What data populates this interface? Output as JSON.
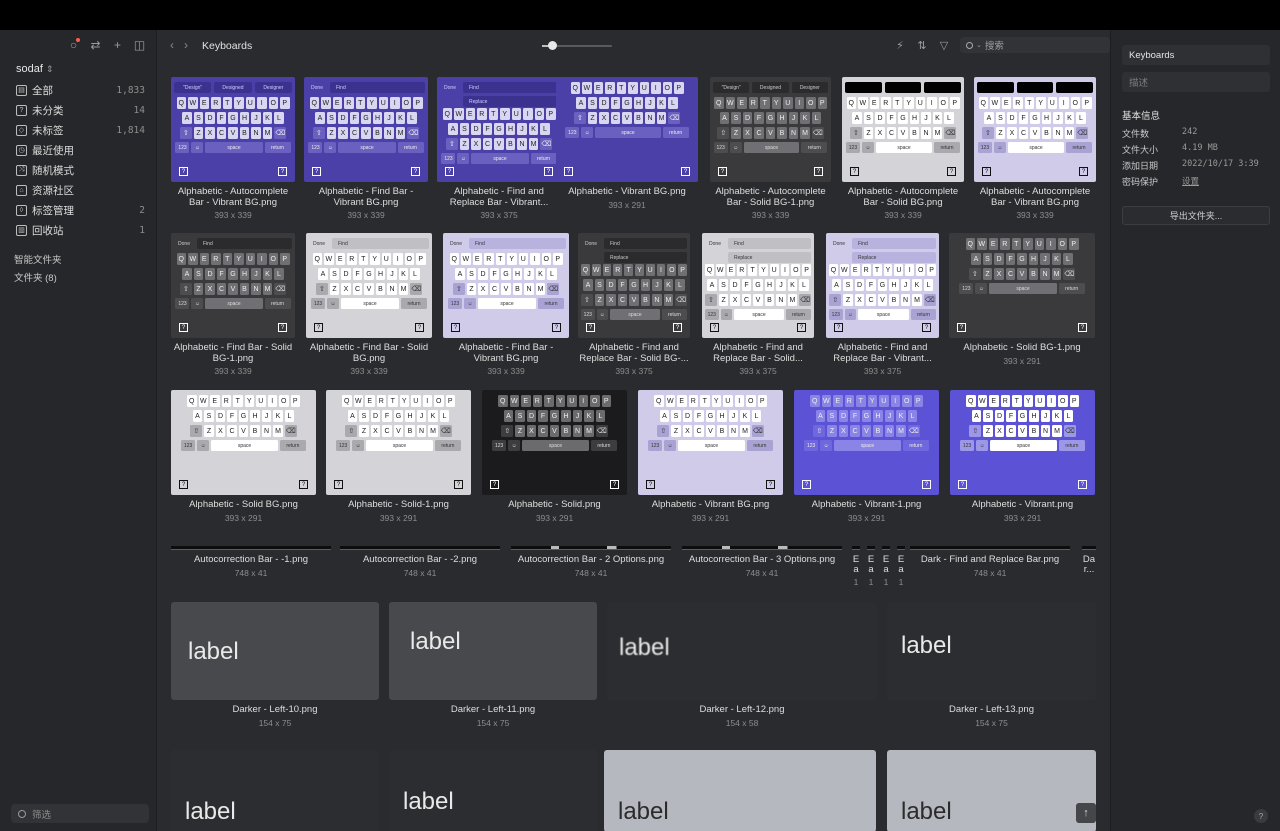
{
  "app": {
    "library": "sodaf",
    "folder": "Keyboards"
  },
  "sidebar": {
    "items": [
      {
        "label": "全部",
        "count": "1,833",
        "icon": "inbox-icon"
      },
      {
        "label": "未分类",
        "count": "14",
        "icon": "unsorted-icon"
      },
      {
        "label": "未标签",
        "count": "1,814",
        "icon": "untagged-icon"
      },
      {
        "label": "最近使用",
        "count": "",
        "icon": "clock-icon"
      },
      {
        "label": "随机模式",
        "count": "",
        "icon": "shuffle-icon"
      },
      {
        "label": "资源社区",
        "count": "",
        "icon": "community-icon"
      },
      {
        "label": "标签管理",
        "count": "2",
        "icon": "tag-icon"
      },
      {
        "label": "回收站",
        "count": "1",
        "icon": "trash-icon"
      }
    ],
    "smart_folders": "智能文件夹",
    "folders": "文件夹 (8)",
    "filter_placeholder": "筛选"
  },
  "toolbar": {
    "title": "Keyboards",
    "search_placeholder": "搜索"
  },
  "inspector": {
    "name": "Keyboards",
    "desc_placeholder": "描述",
    "section": "基本信息",
    "rows": [
      {
        "k": "文件数",
        "v": "242"
      },
      {
        "k": "文件大小",
        "v": "4.19 MB"
      },
      {
        "k": "添加日期",
        "v": "2022/10/17 3:39"
      },
      {
        "k": "密码保护",
        "v": "设置"
      }
    ],
    "export_label": "导出文件夹..."
  },
  "grid": {
    "row1": [
      {
        "cap": "Alphabetic - Autocomplete Bar - Vibrant BG.png",
        "dim": "393 x 339",
        "theme": "vibrant",
        "bar": "auto"
      },
      {
        "cap": "Alphabetic - Find Bar - Vibrant BG.png",
        "dim": "393 x 339",
        "theme": "vibrant",
        "bar": "find"
      },
      {
        "cap": "Alphabetic - Find and Replace Bar - Vibrant...",
        "dim": "393 x 375",
        "theme": "vibrant",
        "bar": "replace"
      },
      {
        "cap": "Alphabetic - Vibrant BG.png",
        "dim": "393 x 291",
        "theme": "vibrant",
        "bar": "none"
      },
      {
        "cap": "Alphabetic - Autocomplete Bar - Solid BG-1.png",
        "dim": "393 x 339",
        "theme": "dark",
        "bar": "auto"
      },
      {
        "cap": "Alphabetic - Autocomplete Bar - Solid BG.png",
        "dim": "393 x 339",
        "theme": "light",
        "bar": "black"
      },
      {
        "cap": "Alphabetic - Autocomplete Bar - Vibrant BG.png",
        "dim": "393 x 339",
        "theme": "lavender",
        "bar": "black"
      }
    ],
    "row2": [
      {
        "cap": "Alphabetic - Find Bar - Solid BG-1.png",
        "dim": "393 x 339",
        "theme": "dark",
        "bar": "find"
      },
      {
        "cap": "Alphabetic - Find Bar - Solid BG.png",
        "dim": "393 x 339",
        "theme": "light",
        "bar": "find"
      },
      {
        "cap": "Alphabetic - Find Bar - Vibrant BG.png",
        "dim": "393 x 339",
        "theme": "lavender",
        "bar": "find"
      },
      {
        "cap": "Alphabetic - Find and Replace Bar - Solid BG-...",
        "dim": "393 x 375",
        "theme": "dark",
        "bar": "replace"
      },
      {
        "cap": "Alphabetic - Find and Replace Bar - Solid...",
        "dim": "393 x 375",
        "theme": "light",
        "bar": "replace"
      },
      {
        "cap": "Alphabetic - Find and Replace Bar - Vibrant...",
        "dim": "393 x 375",
        "theme": "lavender",
        "bar": "replace"
      },
      {
        "cap": "Alphabetic - Solid BG-1.png",
        "dim": "393 x 291",
        "theme": "dark",
        "bar": "none"
      }
    ],
    "row3": [
      {
        "cap": "Alphabetic - Solid BG.png",
        "dim": "393 x 291",
        "theme": "light",
        "bar": "none"
      },
      {
        "cap": "Alphabetic - Solid-1.png",
        "dim": "393 x 291",
        "theme": "light",
        "bar": "none"
      },
      {
        "cap": "Alphabetic - Solid.png",
        "dim": "393 x 291",
        "theme": "black",
        "bar": "none"
      },
      {
        "cap": "Alphabetic - Vibrant BG.png",
        "dim": "393 x 291",
        "theme": "lavender",
        "bar": "none"
      },
      {
        "cap": "Alphabetic - Vibrant-1.png",
        "dim": "393 x 291",
        "theme": "blue",
        "bar": "none"
      },
      {
        "cap": "Alphabetic - Vibrant.png",
        "dim": "393 x 291",
        "theme": "bluelight",
        "bar": "none"
      }
    ],
    "row4": [
      {
        "cap": "Autocorrection Bar - -1.png",
        "dim": "748 x 41"
      },
      {
        "cap": "Autocorrection Bar - -2.png",
        "dim": "748 x 41"
      },
      {
        "cap": "Autocorrection Bar - 2 Options.png",
        "dim": "748 x 41"
      },
      {
        "cap": "Autocorrection Bar - 3 Options.png",
        "dim": "748 x 41"
      },
      {
        "cap": "E",
        "dim": "1",
        "sub": "a"
      },
      {
        "cap": "E",
        "dim": "1",
        "sub": "a"
      },
      {
        "cap": "E",
        "dim": "1",
        "sub": "a"
      },
      {
        "cap": "E",
        "dim": "1",
        "sub": "a"
      },
      {
        "cap": "Dark - Find and Replace Bar.png",
        "dim": "748 x 41"
      },
      {
        "cap": "Da",
        "dim": "",
        "sub": "r..."
      }
    ],
    "row5": [
      {
        "cap": "Darker - Left-10.png",
        "dim": "154 x 75",
        "word": "label"
      },
      {
        "cap": "Darker - Left-11.png",
        "dim": "154 x 75",
        "word": "label"
      },
      {
        "cap": "Darker - Left-12.png",
        "dim": "154 x 58",
        "word": "label"
      },
      {
        "cap": "Darker - Left-13.png",
        "dim": "154 x 75",
        "word": "label"
      }
    ],
    "row6": [
      {
        "word": "label"
      },
      {
        "word": "label"
      },
      {
        "word": "label"
      },
      {
        "word": "label"
      }
    ]
  },
  "keys": {
    "row1": [
      "Q",
      "W",
      "E",
      "R",
      "T",
      "Y",
      "U",
      "I",
      "O",
      "P"
    ],
    "row2": [
      "A",
      "S",
      "D",
      "F",
      "G",
      "H",
      "J",
      "K",
      "L"
    ],
    "row3": [
      "Z",
      "X",
      "C",
      "V",
      "B",
      "N",
      "M"
    ],
    "num": "123",
    "space": "space",
    "ret": "return",
    "done": "Done",
    "find": "Find",
    "replace": "Replace",
    "design": [
      "\"Design\"",
      "Designed",
      "Designer"
    ],
    "shift": "⇧",
    "back": "⌫",
    "emoji": "☺",
    "globe": "?"
  },
  "colors": {
    "vibrant": "#4b40a8",
    "blue": "#5b52d6",
    "lavender": "#cfcbe9"
  }
}
